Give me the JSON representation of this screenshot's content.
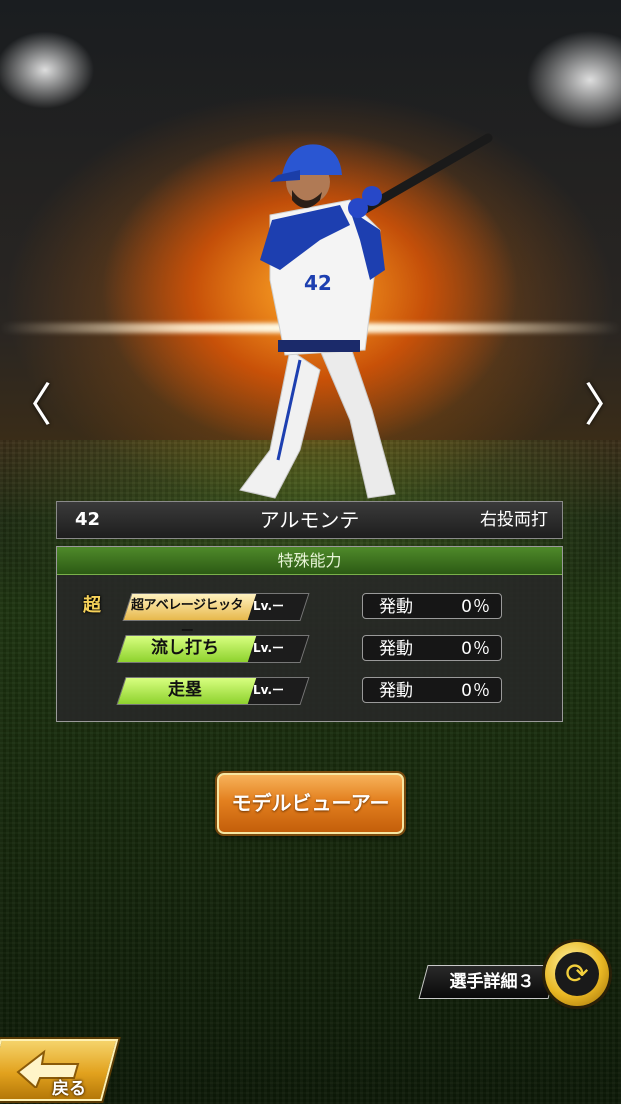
{
  "player": {
    "number": "42",
    "name": "アルモンテ",
    "handedness": "右投両打",
    "jersey_number": "42"
  },
  "abilities": {
    "header": "特殊能力",
    "items": [
      {
        "name": "超アベレージヒッター",
        "badge": "超",
        "level": "Lv.ー",
        "activation_label": "発動",
        "activation_rate": "0％",
        "fill": 1.0,
        "color": "#f0c860"
      },
      {
        "name": "流し打ち",
        "level": "Lv.ー",
        "activation_label": "発動",
        "activation_rate": "0％",
        "fill": 1.0,
        "color": "#a6e23c"
      },
      {
        "name": "走塁",
        "level": "Lv.ー",
        "activation_label": "発動",
        "activation_rate": "0％",
        "fill": 1.0,
        "color": "#a6e23c"
      }
    ]
  },
  "buttons": {
    "model_viewer": "モデルビューアー",
    "player_detail": "選手詳細３",
    "back": "戻る"
  },
  "nav": {
    "prev": "〈",
    "next": "〉"
  },
  "icons": {
    "prev": "chevron-left-icon",
    "next": "chevron-right-icon",
    "swap": "swap-arrows-icon",
    "back": "back-arrow-icon"
  }
}
